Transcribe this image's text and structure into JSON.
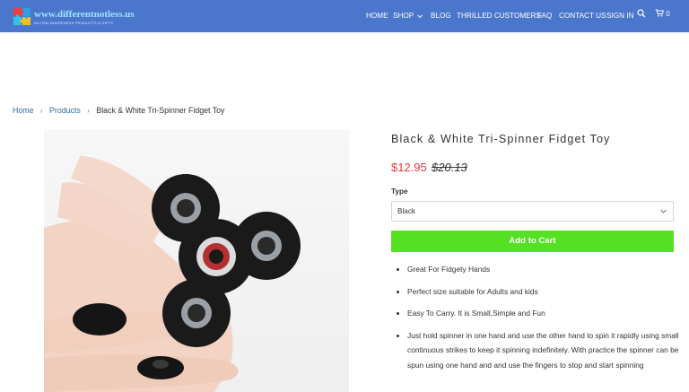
{
  "header": {
    "logo_text": "www.differentnotless.us",
    "logo_tagline": "AUTISM AWARENESS PRODUCTS & GIFTS",
    "nav": {
      "home": "HOME",
      "shop": "SHOP",
      "blog": "BLOG",
      "customers": "THRILLED CUSTOMERS",
      "faq": "FAQ",
      "contact": "CONTACT US",
      "sign_in": "SIGN IN"
    },
    "cart_count": "0"
  },
  "breadcrumb": {
    "home": "Home",
    "products": "Products",
    "current": "Black & White Tri-Spinner Fidget Toy"
  },
  "product": {
    "title": "Black & White Tri-Spinner Fidget Toy",
    "price": "$12.95",
    "compare_price": "$20.13",
    "type_label": "Type",
    "type_selected": "Black",
    "add_to_cart": "Add to Cart",
    "features": [
      "Great For Fidgety Hands",
      "Perfect size suitable for Adults and kids",
      "Easy To Carry. It is Small,Simple and Fun",
      "Just hold spinner in one hand and use the other hand to spin it rapidly using small continuous strikes to keep it spinning indefinitely. With practice the spinner can be spun using one hand and and use the fingers to stop and start spinning"
    ]
  },
  "colors": {
    "header_bg": "#4a76cc",
    "add_to_cart_bg": "#55e024",
    "sale_price": "#e63a3a",
    "link": "#2c6aa0"
  },
  "icons": [
    "puzzle-logo-icon",
    "chevron-down-icon",
    "search-icon",
    "cart-icon",
    "chevron-right-icon"
  ]
}
